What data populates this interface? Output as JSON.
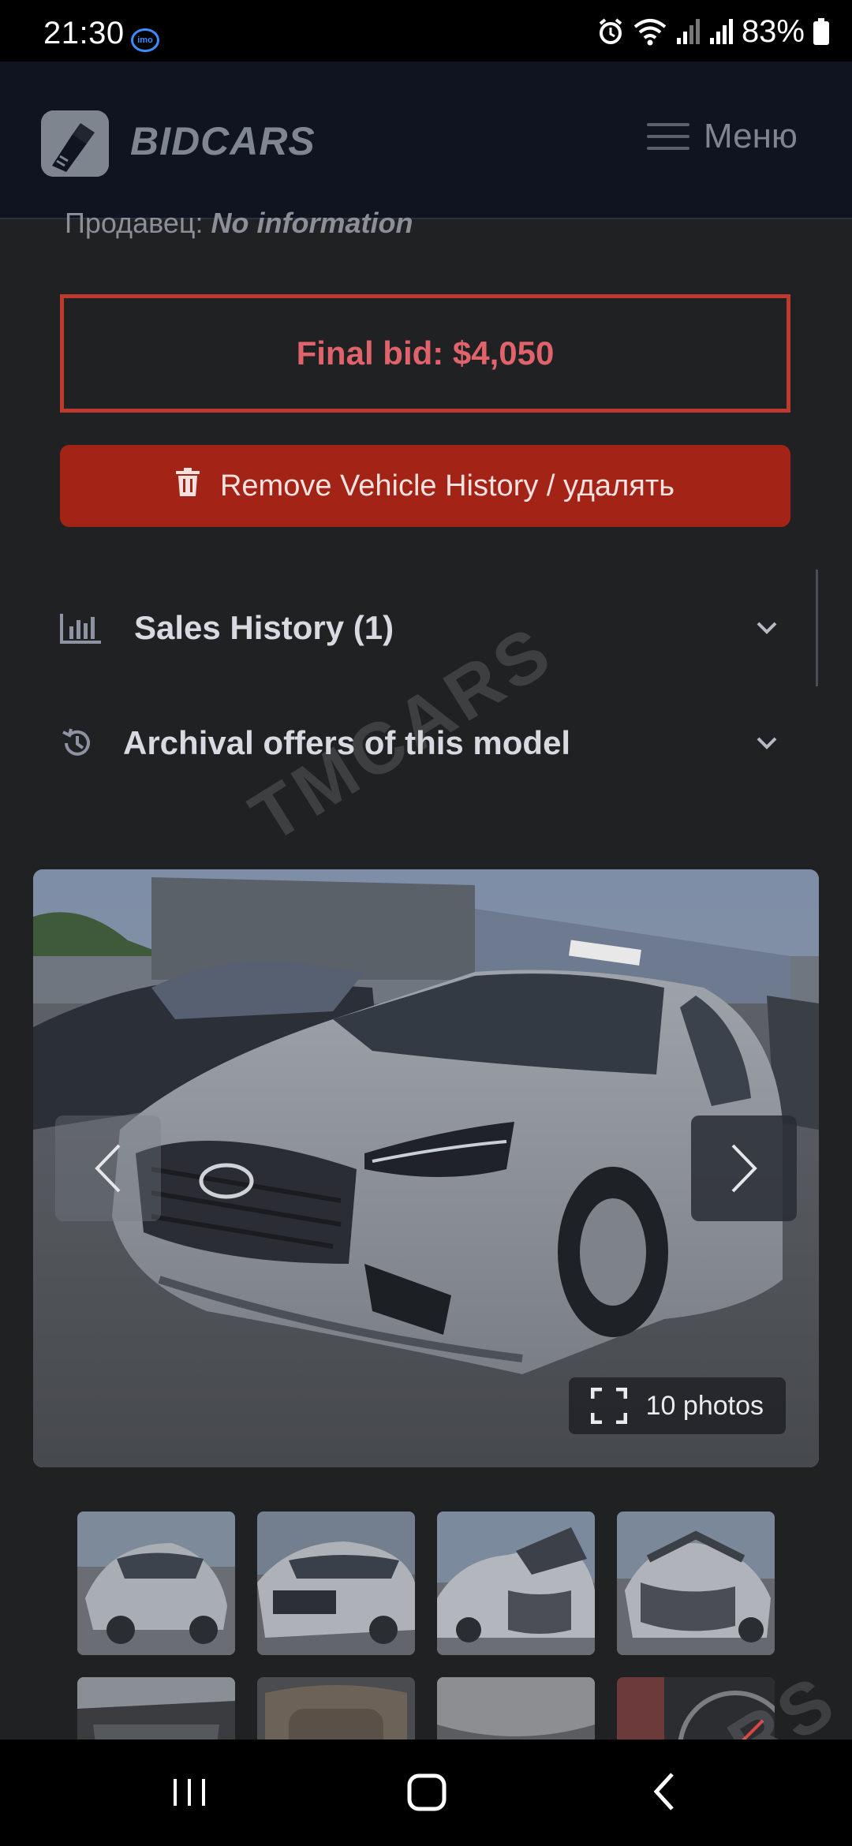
{
  "status_bar": {
    "time": "21:30",
    "imo_badge": "imo",
    "battery": "83%",
    "icons": [
      "alarm-icon",
      "wifi-icon",
      "signal-icon",
      "signal-icon",
      "battery-icon"
    ]
  },
  "header": {
    "brand": "BIDCARS",
    "menu_label": "Меню"
  },
  "seller": {
    "label": "Продавец:",
    "value": "No information"
  },
  "final_bid": {
    "text": "Final bid: $4,050"
  },
  "remove_button": {
    "label": "Remove Vehicle History / удалять"
  },
  "accordions": [
    {
      "label": "Sales History (1)",
      "icon": "bar-chart-icon"
    },
    {
      "label": "Archival offers of this model",
      "icon": "history-icon"
    }
  ],
  "gallery": {
    "photo_count": "10 photos"
  },
  "watermark": {
    "text": "TMCARS"
  },
  "colors": {
    "accent_red": "#a32417",
    "bid_border": "#c0392f",
    "bid_text": "#e0636b",
    "background": "#202123",
    "header_bg": "#0f1420"
  }
}
